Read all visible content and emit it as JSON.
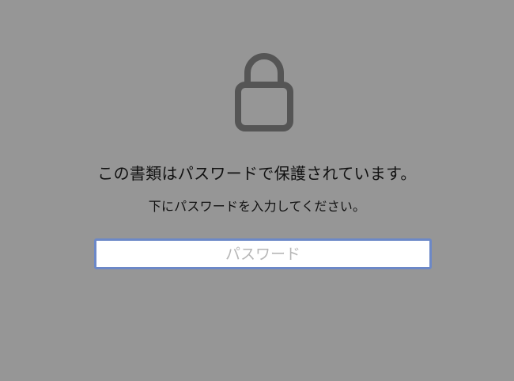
{
  "lock": {
    "icon": "lock-icon",
    "color": "#555555"
  },
  "message": {
    "title": "この書類はパスワードで保護されています。",
    "subtitle": "下にパスワードを入力してください。"
  },
  "password_field": {
    "placeholder": "パスワード",
    "value": "",
    "focus_color": "#6c88c7"
  },
  "colors": {
    "background": "#969696",
    "text": "#111111"
  }
}
